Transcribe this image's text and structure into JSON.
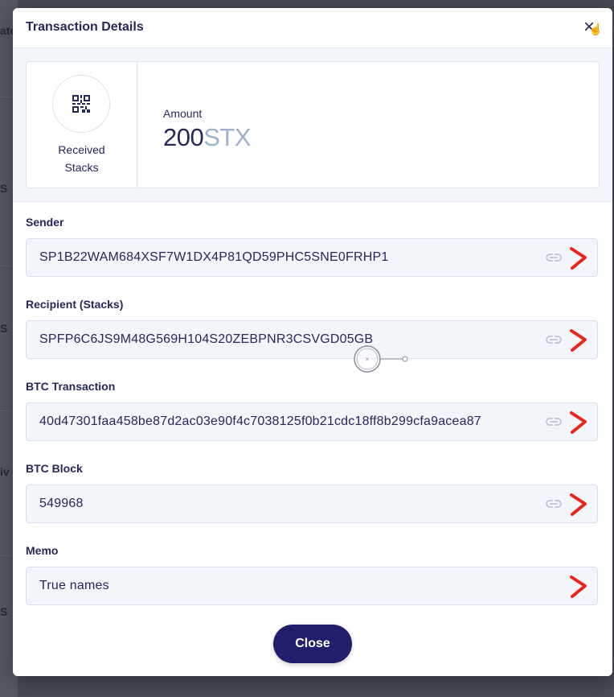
{
  "modal": {
    "title": "Transaction Details",
    "close_icon": "close-icon"
  },
  "summary": {
    "type_icon": "qr-code-icon",
    "type_line1": "Received",
    "type_line2": "Stacks",
    "amount_label": "Amount",
    "amount_value": "200",
    "amount_unit": "STX"
  },
  "fields": [
    {
      "label": "Sender",
      "value": "SP1B22WAM684XSF7W1DX4P81QD59PHC5SNE0FRHP1",
      "link_icon": true
    },
    {
      "label": "Recipient (Stacks)",
      "value": "SPFP6C6JS9M48G569H104S20ZEBPNR3CSVGD05GB",
      "link_icon": true
    },
    {
      "label": "BTC Transaction",
      "value": "40d47301faa458be87d2ac03e90f4c7038125f0b21cdc18ff8b299cfa9acea87",
      "link_icon": true
    },
    {
      "label": "BTC Block",
      "value": "549968",
      "link_icon": true
    },
    {
      "label": "Memo",
      "value": "True names",
      "link_icon": false
    }
  ],
  "footer": {
    "close_label": "Close"
  },
  "colors": {
    "accent": "#211f6b",
    "text": "#26285a",
    "unit": "#9fb1c8",
    "annotation": "#e8271b"
  }
}
